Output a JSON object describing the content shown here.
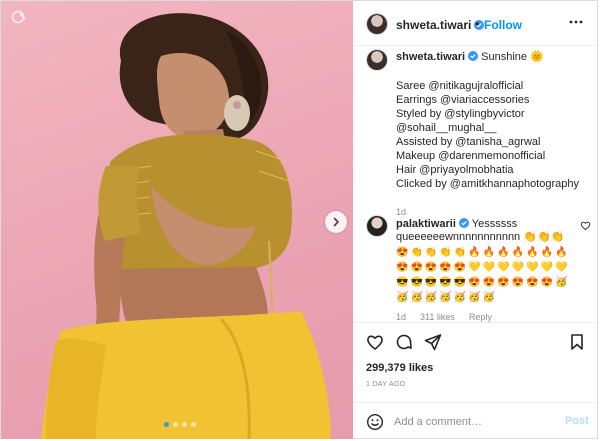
{
  "post": {
    "username": "shweta.tiwari",
    "separator": "•",
    "follow_label": "Follow",
    "caption_text": "Sunshine",
    "caption_emoji": "🌞",
    "caption_lines": [
      "Saree @nitikagujralofficial",
      "Earrings @viariaccessories",
      "Styled by @stylingbyvictor",
      "@sohail__mughal__",
      "Assisted by @tanisha_agrwal",
      "Makeup @darenmemonofficial",
      "Hair @priyayolmobhatia",
      "Clicked by @amitkhannaphotography"
    ],
    "caption_age": "1d",
    "likes": "299,379 likes",
    "date": "1 DAY AGO",
    "accent_color": "#0095f6"
  },
  "comment": {
    "username": "palaktiwarii",
    "text": "Yessssss queeeeeewnnnnnnnnnnn",
    "inline_emojis": [
      "👏",
      "👏",
      "👏"
    ],
    "emoji_rows": [
      [
        "😍",
        "👏",
        "👏",
        "👏",
        "👏",
        "🔥",
        "🔥",
        "🔥",
        "🔥",
        "🔥",
        "🔥",
        "🔥"
      ],
      [
        "😍",
        "😍",
        "😍",
        "😍",
        "😍",
        "💛",
        "💛",
        "💛",
        "💛",
        "💛",
        "💛",
        "💛"
      ],
      [
        "😎",
        "😎",
        "😎",
        "😎",
        "😎",
        "😍",
        "😍",
        "😍",
        "😍",
        "😍",
        "😍",
        "🥳"
      ],
      [
        "🥳",
        "🥳",
        "🥳",
        "🥳",
        "🥳",
        "🥳",
        "🥳"
      ]
    ],
    "age": "1d",
    "likes": "311 likes",
    "reply_label": "Reply"
  },
  "add_comment": {
    "placeholder": "Add a comment…",
    "post_label": "Post"
  },
  "icons": {
    "more": "more-options-icon",
    "like": "heart-icon",
    "comment": "comment-icon",
    "share": "share-icon",
    "save": "bookmark-icon",
    "emoji": "smiley-icon",
    "next": "chevron-right-icon"
  }
}
